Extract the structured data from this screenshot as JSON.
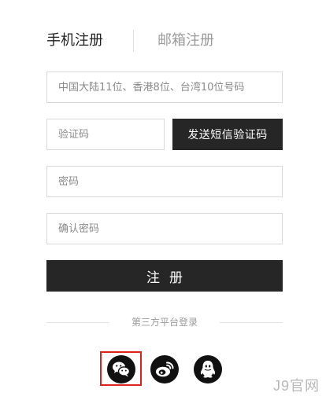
{
  "tabs": {
    "phone_label": "手机注册",
    "email_label": "邮箱注册"
  },
  "form": {
    "phone_placeholder": "中国大陆11位、香港8位、台湾10位号码",
    "code_placeholder": "验证码",
    "send_code_label": "发送短信验证码",
    "password_placeholder": "密码",
    "confirm_placeholder": "确认密码",
    "submit_label": "注册"
  },
  "third_party": {
    "label": "第三方平台登录",
    "providers": [
      "wechat-icon",
      "weibo-icon",
      "qq-icon"
    ]
  },
  "watermark": "J9官网",
  "colors": {
    "button_bg": "#262626",
    "highlight": "#e0201b"
  }
}
